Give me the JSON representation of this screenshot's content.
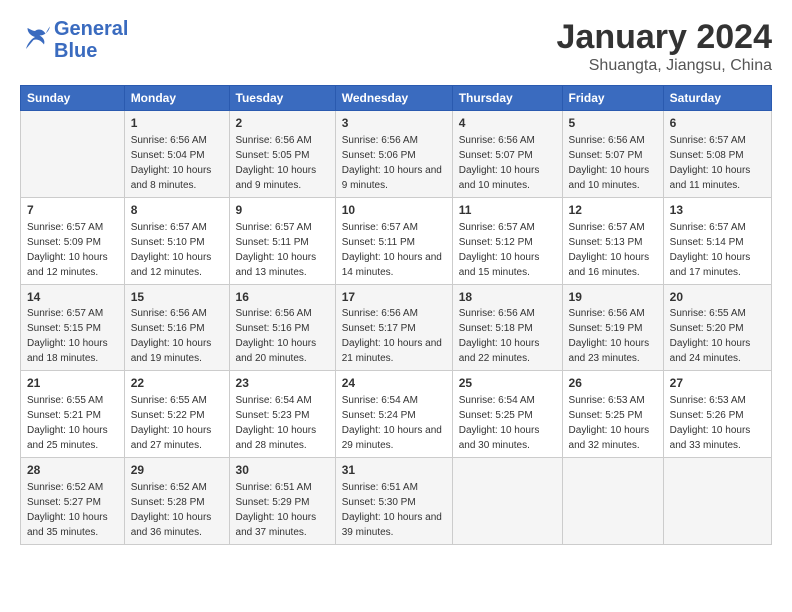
{
  "logo": {
    "line1": "General",
    "line2": "Blue"
  },
  "title": "January 2024",
  "subtitle": "Shuangta, Jiangsu, China",
  "headers": [
    "Sunday",
    "Monday",
    "Tuesday",
    "Wednesday",
    "Thursday",
    "Friday",
    "Saturday"
  ],
  "weeks": [
    [
      {
        "day": "",
        "sunrise": "",
        "sunset": "",
        "daylight": ""
      },
      {
        "day": "1",
        "sunrise": "Sunrise: 6:56 AM",
        "sunset": "Sunset: 5:04 PM",
        "daylight": "Daylight: 10 hours and 8 minutes."
      },
      {
        "day": "2",
        "sunrise": "Sunrise: 6:56 AM",
        "sunset": "Sunset: 5:05 PM",
        "daylight": "Daylight: 10 hours and 9 minutes."
      },
      {
        "day": "3",
        "sunrise": "Sunrise: 6:56 AM",
        "sunset": "Sunset: 5:06 PM",
        "daylight": "Daylight: 10 hours and 9 minutes."
      },
      {
        "day": "4",
        "sunrise": "Sunrise: 6:56 AM",
        "sunset": "Sunset: 5:07 PM",
        "daylight": "Daylight: 10 hours and 10 minutes."
      },
      {
        "day": "5",
        "sunrise": "Sunrise: 6:56 AM",
        "sunset": "Sunset: 5:07 PM",
        "daylight": "Daylight: 10 hours and 10 minutes."
      },
      {
        "day": "6",
        "sunrise": "Sunrise: 6:57 AM",
        "sunset": "Sunset: 5:08 PM",
        "daylight": "Daylight: 10 hours and 11 minutes."
      }
    ],
    [
      {
        "day": "7",
        "sunrise": "Sunrise: 6:57 AM",
        "sunset": "Sunset: 5:09 PM",
        "daylight": "Daylight: 10 hours and 12 minutes."
      },
      {
        "day": "8",
        "sunrise": "Sunrise: 6:57 AM",
        "sunset": "Sunset: 5:10 PM",
        "daylight": "Daylight: 10 hours and 12 minutes."
      },
      {
        "day": "9",
        "sunrise": "Sunrise: 6:57 AM",
        "sunset": "Sunset: 5:11 PM",
        "daylight": "Daylight: 10 hours and 13 minutes."
      },
      {
        "day": "10",
        "sunrise": "Sunrise: 6:57 AM",
        "sunset": "Sunset: 5:11 PM",
        "daylight": "Daylight: 10 hours and 14 minutes."
      },
      {
        "day": "11",
        "sunrise": "Sunrise: 6:57 AM",
        "sunset": "Sunset: 5:12 PM",
        "daylight": "Daylight: 10 hours and 15 minutes."
      },
      {
        "day": "12",
        "sunrise": "Sunrise: 6:57 AM",
        "sunset": "Sunset: 5:13 PM",
        "daylight": "Daylight: 10 hours and 16 minutes."
      },
      {
        "day": "13",
        "sunrise": "Sunrise: 6:57 AM",
        "sunset": "Sunset: 5:14 PM",
        "daylight": "Daylight: 10 hours and 17 minutes."
      }
    ],
    [
      {
        "day": "14",
        "sunrise": "Sunrise: 6:57 AM",
        "sunset": "Sunset: 5:15 PM",
        "daylight": "Daylight: 10 hours and 18 minutes."
      },
      {
        "day": "15",
        "sunrise": "Sunrise: 6:56 AM",
        "sunset": "Sunset: 5:16 PM",
        "daylight": "Daylight: 10 hours and 19 minutes."
      },
      {
        "day": "16",
        "sunrise": "Sunrise: 6:56 AM",
        "sunset": "Sunset: 5:16 PM",
        "daylight": "Daylight: 10 hours and 20 minutes."
      },
      {
        "day": "17",
        "sunrise": "Sunrise: 6:56 AM",
        "sunset": "Sunset: 5:17 PM",
        "daylight": "Daylight: 10 hours and 21 minutes."
      },
      {
        "day": "18",
        "sunrise": "Sunrise: 6:56 AM",
        "sunset": "Sunset: 5:18 PM",
        "daylight": "Daylight: 10 hours and 22 minutes."
      },
      {
        "day": "19",
        "sunrise": "Sunrise: 6:56 AM",
        "sunset": "Sunset: 5:19 PM",
        "daylight": "Daylight: 10 hours and 23 minutes."
      },
      {
        "day": "20",
        "sunrise": "Sunrise: 6:55 AM",
        "sunset": "Sunset: 5:20 PM",
        "daylight": "Daylight: 10 hours and 24 minutes."
      }
    ],
    [
      {
        "day": "21",
        "sunrise": "Sunrise: 6:55 AM",
        "sunset": "Sunset: 5:21 PM",
        "daylight": "Daylight: 10 hours and 25 minutes."
      },
      {
        "day": "22",
        "sunrise": "Sunrise: 6:55 AM",
        "sunset": "Sunset: 5:22 PM",
        "daylight": "Daylight: 10 hours and 27 minutes."
      },
      {
        "day": "23",
        "sunrise": "Sunrise: 6:54 AM",
        "sunset": "Sunset: 5:23 PM",
        "daylight": "Daylight: 10 hours and 28 minutes."
      },
      {
        "day": "24",
        "sunrise": "Sunrise: 6:54 AM",
        "sunset": "Sunset: 5:24 PM",
        "daylight": "Daylight: 10 hours and 29 minutes."
      },
      {
        "day": "25",
        "sunrise": "Sunrise: 6:54 AM",
        "sunset": "Sunset: 5:25 PM",
        "daylight": "Daylight: 10 hours and 30 minutes."
      },
      {
        "day": "26",
        "sunrise": "Sunrise: 6:53 AM",
        "sunset": "Sunset: 5:25 PM",
        "daylight": "Daylight: 10 hours and 32 minutes."
      },
      {
        "day": "27",
        "sunrise": "Sunrise: 6:53 AM",
        "sunset": "Sunset: 5:26 PM",
        "daylight": "Daylight: 10 hours and 33 minutes."
      }
    ],
    [
      {
        "day": "28",
        "sunrise": "Sunrise: 6:52 AM",
        "sunset": "Sunset: 5:27 PM",
        "daylight": "Daylight: 10 hours and 35 minutes."
      },
      {
        "day": "29",
        "sunrise": "Sunrise: 6:52 AM",
        "sunset": "Sunset: 5:28 PM",
        "daylight": "Daylight: 10 hours and 36 minutes."
      },
      {
        "day": "30",
        "sunrise": "Sunrise: 6:51 AM",
        "sunset": "Sunset: 5:29 PM",
        "daylight": "Daylight: 10 hours and 37 minutes."
      },
      {
        "day": "31",
        "sunrise": "Sunrise: 6:51 AM",
        "sunset": "Sunset: 5:30 PM",
        "daylight": "Daylight: 10 hours and 39 minutes."
      },
      {
        "day": "",
        "sunrise": "",
        "sunset": "",
        "daylight": ""
      },
      {
        "day": "",
        "sunrise": "",
        "sunset": "",
        "daylight": ""
      },
      {
        "day": "",
        "sunrise": "",
        "sunset": "",
        "daylight": ""
      }
    ]
  ]
}
